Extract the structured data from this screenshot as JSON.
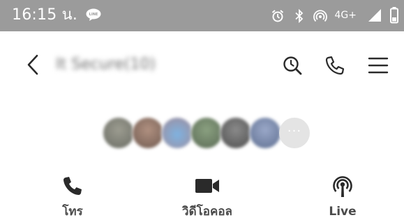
{
  "status_bar": {
    "time": "16:15 น.",
    "network": "4G+",
    "line_badge": "LINE",
    "icons": [
      "alarm-icon",
      "bluetooth-icon",
      "hotspot-icon",
      "signal-icon",
      "battery-icon"
    ]
  },
  "header": {
    "title": "It Secure(10)",
    "icons": [
      "back-icon",
      "search-icon",
      "phone-icon",
      "menu-icon"
    ]
  },
  "members": {
    "avatar_colors": [
      "#7a7d74",
      "#8c7468",
      "#8fa0b8",
      "#6f7f68",
      "#6b6b6b",
      "#8595b4"
    ],
    "more_label": "···"
  },
  "actions": {
    "call_label": "โทร",
    "video_label": "วิดีโอคอล",
    "live_label": "Live"
  },
  "colors": {
    "status_bar": "#9b9b9b",
    "icon": "#2a2a2a",
    "label": "#4b4b4b"
  }
}
